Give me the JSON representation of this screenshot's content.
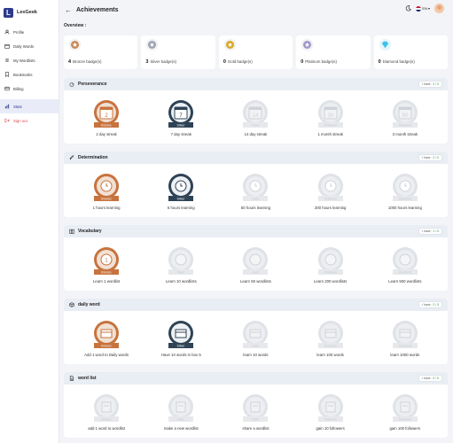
{
  "app": {
    "name": "LexGeek",
    "logo_letter": "L"
  },
  "sidebar": {
    "items": [
      {
        "label": "Profile",
        "icon": "user-icon"
      },
      {
        "label": "Daily Words",
        "icon": "calendar-icon"
      },
      {
        "label": "My Wordlists",
        "icon": "list-icon"
      },
      {
        "label": "Bookmarks",
        "icon": "bookmark-icon"
      },
      {
        "label": "Billing",
        "icon": "card-icon"
      },
      {
        "label": "Stats",
        "icon": "chart-icon",
        "active": true
      },
      {
        "label": "Sign out",
        "icon": "logout-icon",
        "danger": true
      }
    ]
  },
  "header": {
    "back": "←",
    "title": "Achievements",
    "language": "EN"
  },
  "overview": {
    "label": "Overview :",
    "cards": [
      {
        "count": "4",
        "label": "Bronze badge(s)",
        "tier": "bronze",
        "color": "#c98a5a"
      },
      {
        "count": "3",
        "label": "Silver badge(s)",
        "tier": "silver",
        "color": "#9aa4b2"
      },
      {
        "count": "0",
        "label": "Gold badge(s)",
        "tier": "gold",
        "color": "#d9a826"
      },
      {
        "count": "0",
        "label": "Platinum badge(s)",
        "tier": "platinum",
        "color": "#9f99c9"
      },
      {
        "count": "0",
        "label": "Diamond badge(s)",
        "tier": "diamond",
        "color": "#3ec3e8"
      }
    ]
  },
  "sections": [
    {
      "title": "Perseverance",
      "icon": "gauge-icon",
      "have_prefix": "I have :",
      "have_value": "2 / 5",
      "badges": [
        {
          "label": "2 day streak",
          "tier": "Bronze",
          "earned": true,
          "glyph": "2"
        },
        {
          "label": "7 day streak",
          "tier": "Silver",
          "earned": true,
          "glyph": "7"
        },
        {
          "label": "14 day streak",
          "tier": "Gold",
          "earned": false,
          "glyph": "14"
        },
        {
          "label": "1 month streak",
          "tier": "Platinum",
          "earned": false,
          "glyph": "30"
        },
        {
          "label": "3 month streak",
          "tier": "Diamond",
          "earned": false,
          "glyph": "60"
        }
      ]
    },
    {
      "title": "Determination",
      "icon": "rocket-icon",
      "have_prefix": "I have :",
      "have_value": "2 / 5",
      "badges": [
        {
          "label": "1 hours learning",
          "tier": "Bronze",
          "earned": true,
          "glyph": ""
        },
        {
          "label": "5 hours learning",
          "tier": "Silver",
          "earned": true,
          "glyph": ""
        },
        {
          "label": "50 hours learning",
          "tier": "Gold",
          "earned": false,
          "glyph": ""
        },
        {
          "label": "200 hours learning",
          "tier": "Platinum",
          "earned": false,
          "glyph": ""
        },
        {
          "label": "1000 hours learning",
          "tier": "Diamond",
          "earned": false,
          "glyph": ""
        }
      ]
    },
    {
      "title": "Vocabulary",
      "icon": "book-icon",
      "have_prefix": "I have :",
      "have_value": "1 / 5",
      "badges": [
        {
          "label": "Learn 1 wordlist",
          "tier": "Bronze",
          "earned": true,
          "glyph": "1"
        },
        {
          "label": "Learn 10 wordlists",
          "tier": "Silver",
          "earned": false,
          "glyph": ""
        },
        {
          "label": "Learn 50 wordlists",
          "tier": "Gold",
          "earned": false,
          "glyph": ""
        },
        {
          "label": "Learn 200 wordlists",
          "tier": "Platinum",
          "earned": false,
          "glyph": ""
        },
        {
          "label": "Learn 500 wordlists",
          "tier": "Diamond",
          "earned": false,
          "glyph": ""
        }
      ]
    },
    {
      "title": "daily word",
      "icon": "cube-icon",
      "have_prefix": "I have :",
      "have_value": "2 / 5",
      "badges": [
        {
          "label": "Add 1 word to Daily words",
          "tier": "Bronze",
          "earned": true,
          "glyph": ""
        },
        {
          "label": "Have 10 words in box 5",
          "tier": "Silver",
          "earned": true,
          "glyph": ""
        },
        {
          "label": "learn 10 words",
          "tier": "Gold",
          "earned": false,
          "glyph": ""
        },
        {
          "label": "learn 100 words",
          "tier": "Platinum",
          "earned": false,
          "glyph": ""
        },
        {
          "label": "learn 1000 words",
          "tier": "Diamond",
          "earned": false,
          "glyph": ""
        }
      ]
    },
    {
      "title": "word list",
      "icon": "document-icon",
      "have_prefix": "I have :",
      "have_value": "0 / 5",
      "badges": [
        {
          "label": "add 1 word to wordlist",
          "tier": "Bronze",
          "earned": false,
          "glyph": ""
        },
        {
          "label": "make a new wordlist",
          "tier": "Silver",
          "earned": false,
          "glyph": ""
        },
        {
          "label": "share a wordlist",
          "tier": "Gold",
          "earned": false,
          "glyph": ""
        },
        {
          "label": "gain 10 followers",
          "tier": "Platinum",
          "earned": false,
          "glyph": ""
        },
        {
          "label": "gain 100 followers",
          "tier": "Diamond",
          "earned": false,
          "glyph": ""
        }
      ]
    }
  ],
  "colors": {
    "bronze": "#c8733e",
    "silver": "#2f4356",
    "locked": "#dfe2e7",
    "accent": "#2d3a8c",
    "have_green": "#22a04b",
    "danger": "#e04848"
  }
}
